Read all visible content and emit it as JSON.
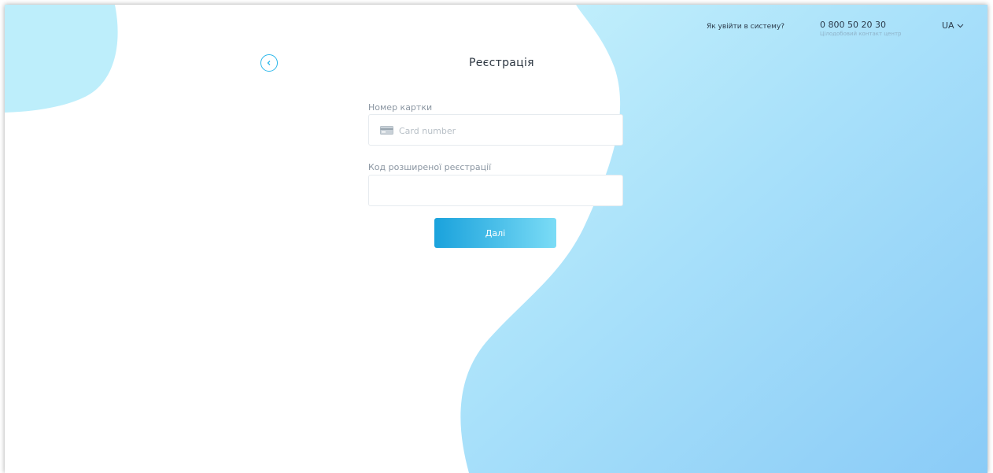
{
  "colors": {
    "accent": "#2ab7ea",
    "blob_light": "#bdeefb",
    "blob_mid": "#a6dcf8",
    "blob_dark": "#8bcdf7",
    "button_start": "#1aa2dc",
    "button_end": "#7bdcf6",
    "text_dark": "#2b3540",
    "label_gray": "#8b96a2"
  },
  "header": {
    "help_link": "Як увійти в систему?",
    "phone": "0 800 50 20 30",
    "phone_caption": "Цілодобовий контакт центр",
    "language": "UA",
    "language_icon": "chevron-down-icon"
  },
  "page": {
    "back_icon": "chevron-left-icon",
    "title": "Реєстрація"
  },
  "form": {
    "card_label": "Номер картки",
    "card_placeholder": "Card number",
    "card_value": "",
    "card_icon": "credit-card-icon",
    "code_label": "Код розширеної реєстрації",
    "code_placeholder": "",
    "code_value": "",
    "submit_label": "Далі"
  }
}
